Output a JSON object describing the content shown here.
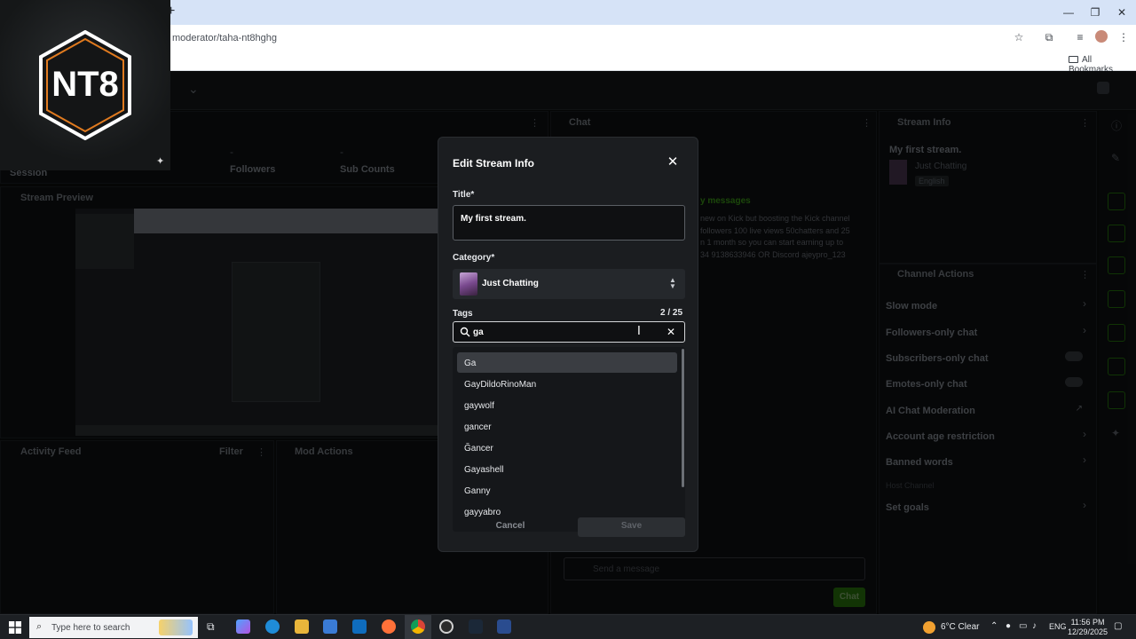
{
  "browser": {
    "address_text": "moderator/taha-nt8hghg",
    "bookmarks_label": "All Bookmarks",
    "new_tab": "+",
    "minimize": "—",
    "restore": "❐",
    "close": "✕"
  },
  "dashboard": {
    "stats": [
      {
        "value": "-",
        "label": "Followers"
      },
      {
        "value": "-",
        "label": "Sub Counts"
      }
    ],
    "session_label": "Session",
    "stream_preview_label": "Stream Preview",
    "activity_feed_label": "Activity Feed",
    "filter_label": "Filter",
    "mod_actions_label": "Mod Actions",
    "chat": {
      "title": "Chat",
      "messages_header": "y messages",
      "message_lines": [
        "new on Kick but boosting the Kick channel",
        "followers 100 live views 50chatters and 25",
        "n 1 month so you can start earning up to",
        "34 9138633946 OR Discord ajeypro_123"
      ],
      "send_placeholder": "Send a message",
      "chat_button": "Chat"
    },
    "stream_info": {
      "title": "Stream Info",
      "stream_title": "My first stream.",
      "category": "Just Chatting",
      "language": "English"
    },
    "channel_actions": {
      "title": "Channel Actions",
      "items": [
        {
          "label": "Slow mode",
          "control": "chevron"
        },
        {
          "label": "Followers-only chat",
          "control": "chevron"
        },
        {
          "label": "Subscribers-only chat",
          "control": "toggle"
        },
        {
          "label": "Emotes-only chat",
          "control": "toggle"
        },
        {
          "label": "AI Chat Moderation",
          "control": "external"
        },
        {
          "label": "Account age restriction",
          "control": "chevron"
        },
        {
          "label": "Banned words",
          "control": "chevron"
        },
        {
          "label": "Host Channel",
          "control": "none"
        },
        {
          "label": "Set goals",
          "control": "chevron"
        }
      ]
    }
  },
  "modal": {
    "title": "Edit Stream Info",
    "close_glyph": "✕",
    "title_label": "Title*",
    "title_value": "My first stream.",
    "category_label": "Category*",
    "category_value": "Just Chatting",
    "tags_label": "Tags",
    "tags_count": "2 / 25",
    "tags_query": "ga",
    "clear_glyph": "✕",
    "suggestions": [
      "Ga",
      "GayDildoRinoMan",
      "gaywolf",
      "gancer",
      "Ğancer",
      "Gayashell",
      "Ganny",
      "gayyabro"
    ],
    "cancel_label": "Cancel",
    "save_label": "Save"
  },
  "taskbar": {
    "search_placeholder": "Type here to search",
    "weather": "6°C  Clear",
    "language": "ENG",
    "time": "11:56 PM",
    "date": "12/29/2025"
  },
  "colors": {
    "accent_green": "#53fc18",
    "modal_bg": "#1b1d20",
    "chrome_tab_bg": "#d6e3f7"
  },
  "webcam_logo_text": "NT8"
}
